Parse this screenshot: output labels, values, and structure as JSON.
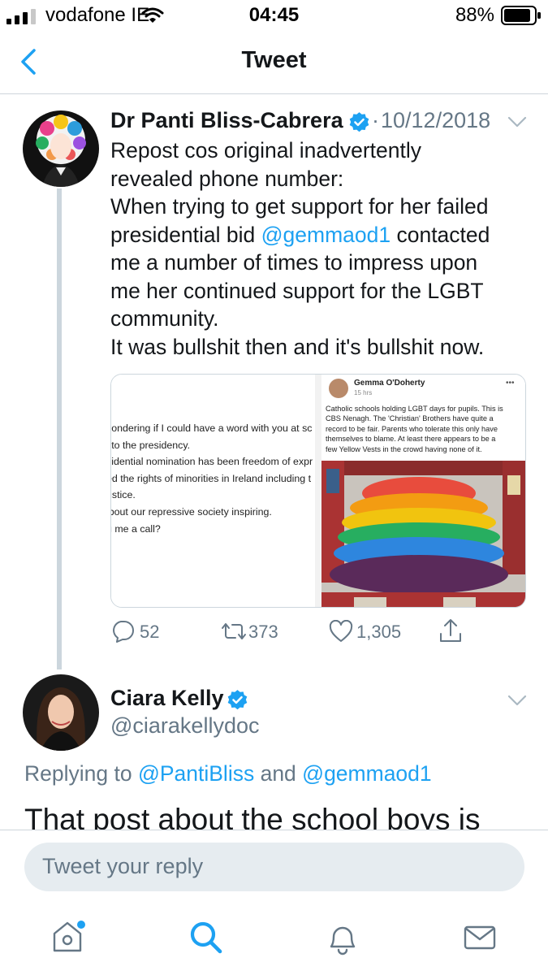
{
  "status_bar": {
    "carrier": "vodafone IE",
    "time": "04:45",
    "battery": "88%"
  },
  "header": {
    "title": "Tweet"
  },
  "tweet": {
    "author": "Dr Panti Bliss-Cabrera",
    "date": "10/12/2018",
    "lines": [
      "Repost cos original inadvertently",
      "revealed phone number:",
      "When trying to get support for her failed",
      "presidential bid ",
      "@gemmaod1",
      " contacted",
      "me a number of times to impress upon",
      "me her continued support for the LGBT",
      "community.",
      "It was bullshit then and it's bullshit now."
    ],
    "media_left_lines": [
      "vondering if I could have a word with you at sc",
      "i to the presidency.",
      "sidential nomination has been freedom of expr",
      "ed the rights of minorities in Ireland including t",
      "ustice.",
      "ibout our repressive society inspiring.",
      "g me a call?"
    ],
    "media_right": {
      "author": "Gemma O'Doherty",
      "time": "15 hrs",
      "more": "•••",
      "lines": [
        "Catholic schools holding LGBT days for pupils. This is",
        "CBS Nenagh. The 'Christian' Brothers have quite a",
        "record to be fair. Parents who tolerate this only have",
        "themselves to blame. At least there appears to be a",
        "few Yellow Vests in the crowd having none of it."
      ]
    },
    "replies": "52",
    "retweets": "373",
    "likes": "1,305"
  },
  "reply_tweet": {
    "author": "Ciara Kelly",
    "handle": "@ciarakellydoc",
    "replying_prefix": "Replying to ",
    "replying_to_1": "@PantiBliss",
    "replying_and": " and ",
    "replying_to_2": "@gemmaod1",
    "text_partial": "That post about the school boys is"
  },
  "reply_box": {
    "placeholder": "Tweet your reply"
  },
  "tab_bar": {
    "items": [
      "home",
      "search",
      "notifications",
      "messages"
    ]
  },
  "colors": {
    "accent": "#1da1f2",
    "secondary_text": "#657786",
    "verified": "#1da1f2"
  }
}
